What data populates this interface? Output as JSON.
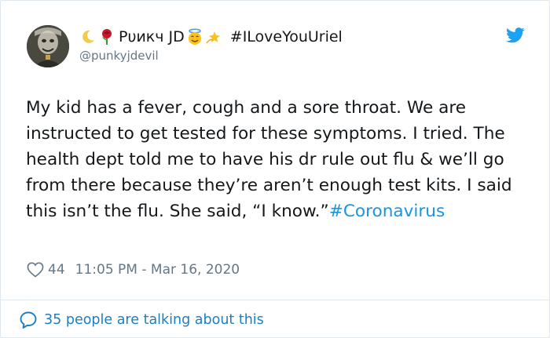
{
  "tweet": {
    "author": {
      "emoji_before": [
        "crescent-moon-icon",
        "rose-icon"
      ],
      "name": "Рυикч JD",
      "emoji_after": [
        "smiling-face-with-halo-icon",
        "dizzy-star-icon"
      ],
      "name_hashtag": "#ILoveYouUriel",
      "handle": "@punkyjdevil"
    },
    "text": "My kid has a fever, cough and a sore throat. We are instructed to get tested for these symptoms. I tried. The health dept told me to have his dr rule out flu & we’ll go from there because they’re aren’t enough test kits. I said this isn’t the flu. She said, “I know.”",
    "hashtag": "#Coronavirus",
    "likes": "44",
    "timestamp": "11:05 PM - Mar 16, 2020",
    "conversation_text": "35 people are talking about this"
  },
  "colors": {
    "text": "#14171a",
    "secondary": "#657786",
    "link": "#1b95e0",
    "twitter_blue": "#1da1f2",
    "border": "#e1e8ed"
  },
  "icons": {
    "brand": "twitter-bird-icon",
    "like": "heart-icon",
    "conversation": "speech-bubble-icon"
  }
}
